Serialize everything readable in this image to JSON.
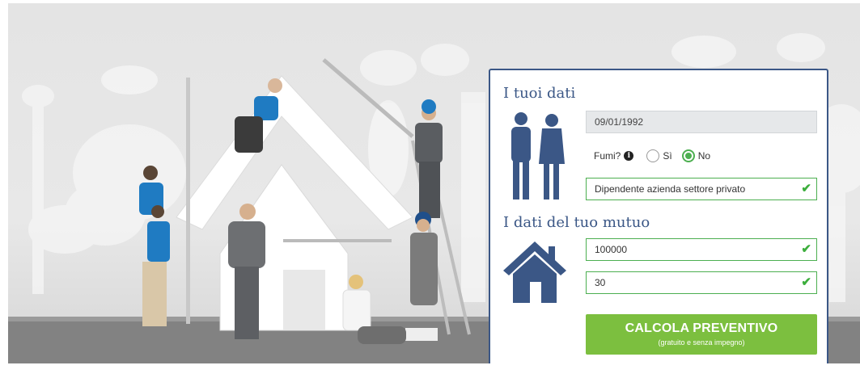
{
  "form": {
    "section1_title": "I tuoi dati",
    "birthdate_value": "09/01/1992",
    "smoke_label": "Fumi?",
    "smoke_yes": "Sì",
    "smoke_no": "No",
    "smoke_selected": "No",
    "occupation_value": "Dipendente azienda settore privato",
    "section2_title": "I dati del tuo mutuo",
    "amount_value": "100000",
    "duration_value": "30",
    "cta_label": "CALCOLA PREVENTIVO",
    "cta_sub": "(gratuito e senza impegno)"
  },
  "icons": {
    "info": "i",
    "check": "✔"
  },
  "colors": {
    "brand_blue": "#3b5786",
    "accent_green": "#7cbf3f",
    "valid_green": "#4caf50"
  }
}
